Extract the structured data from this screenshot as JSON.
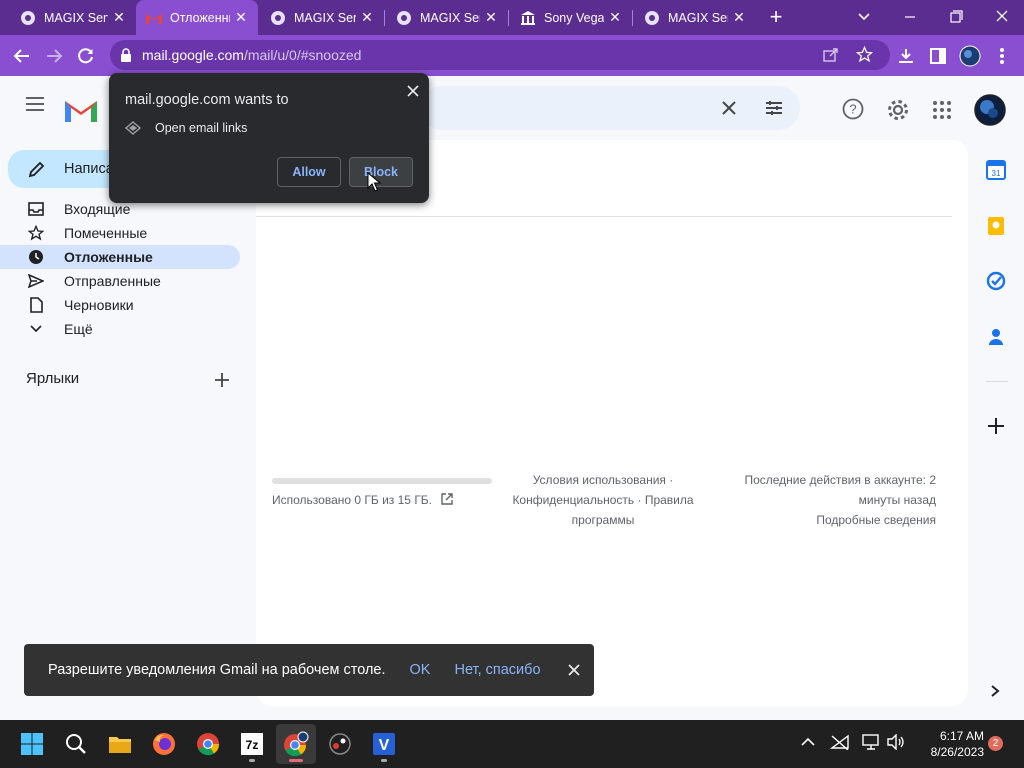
{
  "browser": {
    "tabs": [
      {
        "title": "MAGIX Servi",
        "icon": "magix-globe-icon",
        "active": false
      },
      {
        "title": "Отложенные",
        "icon": "gmail-icon",
        "active": true
      },
      {
        "title": "MAGIX Servi",
        "icon": "magix-globe-icon",
        "active": false
      },
      {
        "title": "MAGIX Servi",
        "icon": "magix-globe-icon",
        "active": false
      },
      {
        "title": "Sony Vegas",
        "icon": "museum-icon",
        "active": false
      },
      {
        "title": "MAGIX Servi",
        "icon": "magix-globe-icon",
        "active": false
      }
    ],
    "url_host": "mail.google.com",
    "url_path": "/mail/u/0/#snoozed"
  },
  "permission_popup": {
    "title": "mail.google.com wants to",
    "item": "Open email links",
    "allow_label": "Allow",
    "block_label": "Block"
  },
  "gmail": {
    "compose_label": "Написать",
    "nav": [
      {
        "label": "Входящие",
        "icon": "inbox-icon",
        "selected": false
      },
      {
        "label": "Помеченные",
        "icon": "star-icon",
        "selected": false
      },
      {
        "label": "Отложенные",
        "icon": "clock-icon",
        "selected": true
      },
      {
        "label": "Отправленные",
        "icon": "send-icon",
        "selected": false
      },
      {
        "label": "Черновики",
        "icon": "draft-icon",
        "selected": false
      },
      {
        "label": "Ещё",
        "icon": "chevron-down-icon",
        "selected": false
      }
    ],
    "labels_heading": "Ярлыки",
    "footer": {
      "storage": "Использовано 0 ГБ из 15 ГБ.",
      "storage_fraction": 0.0,
      "terms_line1": "Условия использования ·",
      "terms_line2": "Конфиденциальность · Правила",
      "terms_line3": "программы",
      "activity_line1": "Последние действия в аккаунте: 2",
      "activity_line2": "минуты назад",
      "activity_line3": "Подробные сведения"
    }
  },
  "snackbar": {
    "message": "Разрешите уведомления Gmail на рабочем столе.",
    "ok_label": "OK",
    "no_label": "Нет, спасибо"
  },
  "taskbar": {
    "time": "6:17 AM",
    "date": "8/26/2023",
    "notification_count": "2"
  },
  "colors": {
    "tab_strip": "#5c2d91",
    "toolbar": "#8a4fd1",
    "selected_nav": "#d3e3fd",
    "link_blue": "#8ab4f8"
  }
}
